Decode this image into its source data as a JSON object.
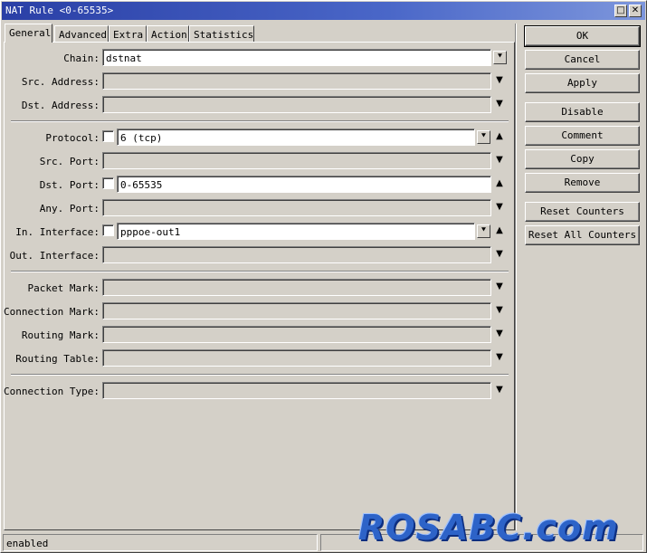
{
  "window": {
    "title": "NAT Rule <0-65535>",
    "maximize_glyph": "□",
    "close_glyph": "✕"
  },
  "tabs": [
    {
      "label": "General",
      "active": true
    },
    {
      "label": "Advanced"
    },
    {
      "label": "Extra"
    },
    {
      "label": "Action"
    },
    {
      "label": "Statistics"
    }
  ],
  "form": {
    "chain": {
      "label": "Chain:",
      "value": "dstnat"
    },
    "src_address": {
      "label": "Src. Address:",
      "value": ""
    },
    "dst_address": {
      "label": "Dst. Address:",
      "value": ""
    },
    "protocol": {
      "label": "Protocol:",
      "value": "6 (tcp)"
    },
    "src_port": {
      "label": "Src. Port:",
      "value": ""
    },
    "dst_port": {
      "label": "Dst. Port:",
      "value": "0-65535"
    },
    "any_port": {
      "label": "Any. Port:",
      "value": ""
    },
    "in_interface": {
      "label": "In. Interface:",
      "value": "pppoe-out1"
    },
    "out_interface": {
      "label": "Out. Interface:",
      "value": ""
    },
    "packet_mark": {
      "label": "Packet Mark:",
      "value": ""
    },
    "connection_mark": {
      "label": "Connection Mark:",
      "value": ""
    },
    "routing_mark": {
      "label": "Routing Mark:",
      "value": ""
    },
    "routing_table": {
      "label": "Routing Table:",
      "value": ""
    },
    "connection_type": {
      "label": "Connection Type:",
      "value": ""
    }
  },
  "glyphs": {
    "dropdown": "▼",
    "dropdown_button": "⯆",
    "collapse_up": "▲"
  },
  "buttons": {
    "ok": "OK",
    "cancel": "Cancel",
    "apply": "Apply",
    "disable": "Disable",
    "comment": "Comment",
    "copy": "Copy",
    "remove": "Remove",
    "reset_counters": "Reset Counters",
    "reset_all_counters": "Reset All Counters"
  },
  "status": {
    "state": "enabled"
  },
  "watermark": "ROSABC.com"
}
